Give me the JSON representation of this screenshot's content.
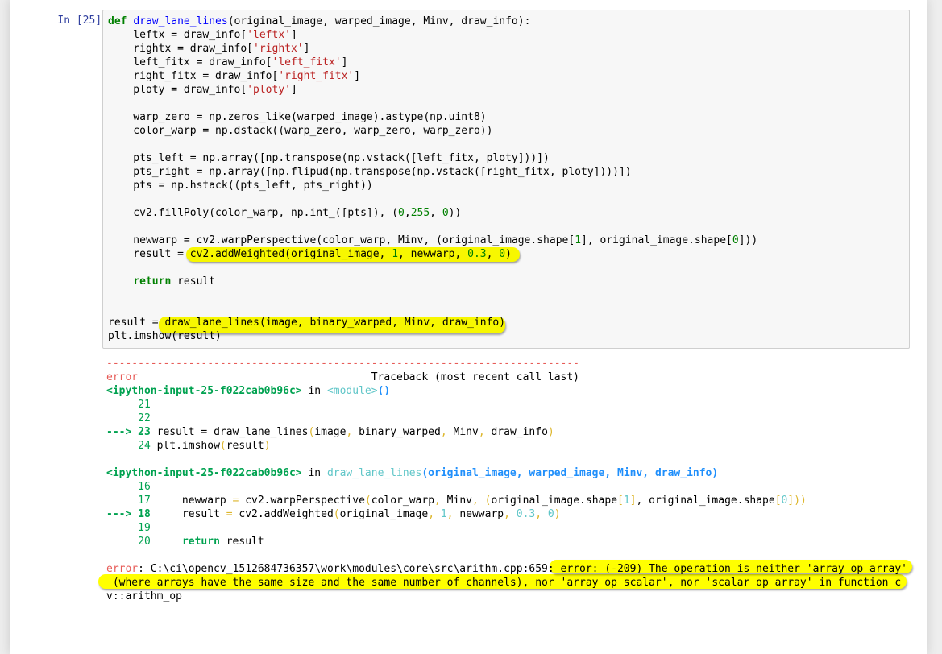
{
  "cell": {
    "prompt": "In [25]:",
    "code_lines": [
      {
        "parts": [
          {
            "t": "def",
            "c": "kw"
          },
          {
            "t": " "
          },
          {
            "t": "draw_lane_lines",
            "c": "fn"
          },
          {
            "t": "(original_image, warped_image, Minv, draw_info):"
          }
        ]
      },
      {
        "parts": [
          {
            "t": "    leftx = draw_info["
          },
          {
            "t": "'leftx'",
            "c": "st"
          },
          {
            "t": "]"
          }
        ]
      },
      {
        "parts": [
          {
            "t": "    rightx = draw_info["
          },
          {
            "t": "'rightx'",
            "c": "st"
          },
          {
            "t": "]"
          }
        ]
      },
      {
        "parts": [
          {
            "t": "    left_fitx = draw_info["
          },
          {
            "t": "'left_fitx'",
            "c": "st"
          },
          {
            "t": "]"
          }
        ]
      },
      {
        "parts": [
          {
            "t": "    right_fitx = draw_info["
          },
          {
            "t": "'right_fitx'",
            "c": "st"
          },
          {
            "t": "]"
          }
        ]
      },
      {
        "parts": [
          {
            "t": "    ploty = draw_info["
          },
          {
            "t": "'ploty'",
            "c": "st"
          },
          {
            "t": "]"
          }
        ]
      },
      {
        "parts": [
          {
            "t": ""
          }
        ]
      },
      {
        "parts": [
          {
            "t": "    warp_zero = np.zeros_like(warped_image).astype(np.uint8)"
          }
        ]
      },
      {
        "parts": [
          {
            "t": "    color_warp = np.dstack((warp_zero, warp_zero, warp_zero))"
          }
        ]
      },
      {
        "parts": [
          {
            "t": ""
          }
        ]
      },
      {
        "parts": [
          {
            "t": "    pts_left = np.array([np.transpose(np.vstack([left_fitx, ploty]))])"
          }
        ]
      },
      {
        "parts": [
          {
            "t": "    pts_right = np.array([np.flipud(np.transpose(np.vstack([right_fitx, ploty])))])"
          }
        ]
      },
      {
        "parts": [
          {
            "t": "    pts = np.hstack((pts_left, pts_right))"
          }
        ]
      },
      {
        "parts": [
          {
            "t": ""
          }
        ]
      },
      {
        "parts": [
          {
            "t": "    cv2.fillPoly(color_warp, np.int_([pts]), ("
          },
          {
            "t": "0",
            "c": "nm"
          },
          {
            "t": ","
          },
          {
            "t": "255",
            "c": "nm"
          },
          {
            "t": ", "
          },
          {
            "t": "0",
            "c": "nm"
          },
          {
            "t": "))"
          }
        ]
      },
      {
        "parts": [
          {
            "t": ""
          }
        ]
      },
      {
        "parts": [
          {
            "t": "    newwarp = cv2.warpPerspective(color_warp, Minv, (original_image.shape["
          },
          {
            "t": "1",
            "c": "nm"
          },
          {
            "t": "], original_image.shape["
          },
          {
            "t": "0",
            "c": "nm"
          },
          {
            "t": "]))"
          }
        ]
      },
      {
        "parts": [
          {
            "t": "    result = cv2.addWeighted(original_image, "
          },
          {
            "t": "1",
            "c": "nm"
          },
          {
            "t": ", newwarp, "
          },
          {
            "t": "0.3",
            "c": "nm"
          },
          {
            "t": ", "
          },
          {
            "t": "0",
            "c": "nm"
          },
          {
            "t": ")"
          }
        ]
      },
      {
        "parts": [
          {
            "t": ""
          }
        ]
      },
      {
        "parts": [
          {
            "t": "    "
          },
          {
            "t": "return",
            "c": "kw"
          },
          {
            "t": " result"
          }
        ]
      },
      {
        "parts": [
          {
            "t": ""
          }
        ]
      },
      {
        "parts": [
          {
            "t": ""
          }
        ]
      },
      {
        "parts": [
          {
            "t": "result = draw_lane_lines(image, binary_warped, Minv, draw_info)"
          }
        ]
      },
      {
        "parts": [
          {
            "t": "plt.imshow(result)"
          }
        ]
      }
    ]
  },
  "output": {
    "lines": [
      {
        "parts": [
          {
            "t": "---------------------------------------------------------------------------",
            "c": "ansi-red"
          }
        ]
      },
      {
        "parts": [
          {
            "t": "error",
            "c": "ansi-red"
          },
          {
            "t": "                                     Traceback (most recent call last)"
          }
        ]
      },
      {
        "parts": [
          {
            "t": "<ipython-input-25-f022cab0b96c>",
            "c": "ansi-green-b"
          },
          {
            "t": " in "
          },
          {
            "t": "<module>",
            "c": "ansi-cyan"
          },
          {
            "t": "()",
            "c": "ansi-blue-b"
          }
        ]
      },
      {
        "parts": [
          {
            "t": "     21",
            "c": "ansi-green"
          }
        ]
      },
      {
        "parts": [
          {
            "t": "     22",
            "c": "ansi-green"
          }
        ]
      },
      {
        "parts": [
          {
            "t": "---> 23 ",
            "c": "ansi-green-b"
          },
          {
            "t": "result = draw_lane_lines"
          },
          {
            "t": "(",
            "c": "ansi-yellow"
          },
          {
            "t": "image"
          },
          {
            "t": ",",
            "c": "ansi-yellow"
          },
          {
            "t": " binary_warped"
          },
          {
            "t": ",",
            "c": "ansi-yellow"
          },
          {
            "t": " Minv"
          },
          {
            "t": ",",
            "c": "ansi-yellow"
          },
          {
            "t": " draw_info"
          },
          {
            "t": ")",
            "c": "ansi-yellow"
          }
        ]
      },
      {
        "parts": [
          {
            "t": "     24 ",
            "c": "ansi-green"
          },
          {
            "t": "plt.imshow"
          },
          {
            "t": "(",
            "c": "ansi-yellow"
          },
          {
            "t": "result"
          },
          {
            "t": ")",
            "c": "ansi-yellow"
          }
        ]
      },
      {
        "parts": [
          {
            "t": ""
          }
        ]
      },
      {
        "parts": [
          {
            "t": "<ipython-input-25-f022cab0b96c>",
            "c": "ansi-green-b"
          },
          {
            "t": " in "
          },
          {
            "t": "draw_lane_lines",
            "c": "ansi-cyan"
          },
          {
            "t": "(original_image, warped_image, Minv, draw_info)",
            "c": "ansi-blue-b"
          }
        ]
      },
      {
        "parts": [
          {
            "t": "     16",
            "c": "ansi-green"
          }
        ]
      },
      {
        "parts": [
          {
            "t": "     17 ",
            "c": "ansi-green"
          },
          {
            "t": "    newwarp "
          },
          {
            "t": "=",
            "c": "ansi-yellow"
          },
          {
            "t": " cv2.warpPerspective"
          },
          {
            "t": "(",
            "c": "ansi-yellow"
          },
          {
            "t": "color_warp"
          },
          {
            "t": ",",
            "c": "ansi-yellow"
          },
          {
            "t": " Minv"
          },
          {
            "t": ",",
            "c": "ansi-yellow"
          },
          {
            "t": " "
          },
          {
            "t": "(",
            "c": "ansi-yellow"
          },
          {
            "t": "original_image.shape"
          },
          {
            "t": "[",
            "c": "ansi-yellow"
          },
          {
            "t": "1",
            "c": "ansi-cyan"
          },
          {
            "t": "]",
            "c": "ansi-yellow"
          },
          {
            "t": ","
          },
          {
            "t": " original_image.shape"
          },
          {
            "t": "[",
            "c": "ansi-yellow"
          },
          {
            "t": "0",
            "c": "ansi-cyan"
          },
          {
            "t": "]))",
            "c": "ansi-yellow"
          }
        ]
      },
      {
        "parts": [
          {
            "t": "---> 18 ",
            "c": "ansi-green-b"
          },
          {
            "t": "    result "
          },
          {
            "t": "=",
            "c": "ansi-yellow"
          },
          {
            "t": " cv2.addWeighted"
          },
          {
            "t": "(",
            "c": "ansi-yellow"
          },
          {
            "t": "original_image"
          },
          {
            "t": ",",
            "c": "ansi-yellow"
          },
          {
            "t": " "
          },
          {
            "t": "1",
            "c": "ansi-cyan"
          },
          {
            "t": ",",
            "c": "ansi-yellow"
          },
          {
            "t": " newwarp"
          },
          {
            "t": ",",
            "c": "ansi-yellow"
          },
          {
            "t": " "
          },
          {
            "t": "0.3",
            "c": "ansi-cyan"
          },
          {
            "t": ",",
            "c": "ansi-yellow"
          },
          {
            "t": " "
          },
          {
            "t": "0",
            "c": "ansi-cyan"
          },
          {
            "t": ")",
            "c": "ansi-yellow"
          }
        ]
      },
      {
        "parts": [
          {
            "t": "     19",
            "c": "ansi-green"
          }
        ]
      },
      {
        "parts": [
          {
            "t": "     20 ",
            "c": "ansi-green"
          },
          {
            "t": "    "
          },
          {
            "t": "return",
            "c": "ansi-green-b"
          },
          {
            "t": " result"
          }
        ]
      },
      {
        "parts": [
          {
            "t": ""
          }
        ]
      },
      {
        "parts": [
          {
            "t": "error",
            "c": "ansi-red"
          },
          {
            "t": ": C:\\ci\\opencv_1512684736357\\work\\modules\\core\\src\\arithm.cpp:659: error: (-209) The operation is neither 'array op array'"
          }
        ]
      },
      {
        "parts": [
          {
            "t": " (where arrays have the same size and the same number of channels), nor 'array op scalar', nor 'scalar op array' in function c"
          }
        ]
      },
      {
        "parts": [
          {
            "t": "v::arithm_op"
          }
        ]
      }
    ]
  }
}
